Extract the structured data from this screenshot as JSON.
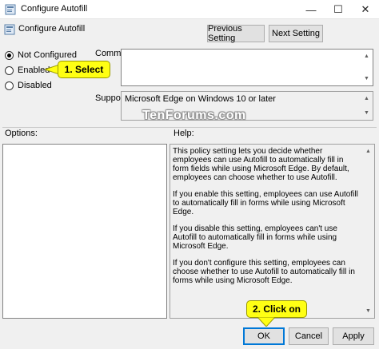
{
  "window": {
    "title": "Configure Autofill",
    "minimize_glyph": "—",
    "maximize_glyph": "☐",
    "close_glyph": "✕"
  },
  "header": {
    "title": "Configure Autofill",
    "previous_setting": "Previous Setting",
    "next_setting": "Next Setting"
  },
  "state": {
    "options": [
      {
        "label": "Not Configured",
        "checked": true
      },
      {
        "label": "Enabled",
        "checked": false
      },
      {
        "label": "Disabled",
        "checked": false
      }
    ]
  },
  "comment": {
    "label": "Comment:",
    "value": ""
  },
  "supported": {
    "label": "Supported on:",
    "value": "Microsoft Edge on Windows 10 or later"
  },
  "watermark": "TenForums.com",
  "options_label": "Options:",
  "help": {
    "label": "Help:",
    "paragraphs": [
      "This policy setting lets you decide whether employees can use Autofill to automatically fill in form fields while using Microsoft Edge. By default, employees can choose whether to use Autofill.",
      "If you enable this setting, employees can use Autofill to automatically fill in forms while using Microsoft Edge.",
      "If you disable this setting, employees can't use Autofill to automatically fill in forms while using Microsoft Edge.",
      "If you don't configure this setting, employees can choose whether to use Autofill to automatically fill in forms while using Microsoft Edge."
    ]
  },
  "callouts": {
    "select": "1. Select",
    "click_on": "2. Click on"
  },
  "footer": {
    "ok": "OK",
    "cancel": "Cancel",
    "apply": "Apply"
  },
  "colors": {
    "callout_fill": "#ffff14",
    "default_button_border": "#0078d7"
  }
}
